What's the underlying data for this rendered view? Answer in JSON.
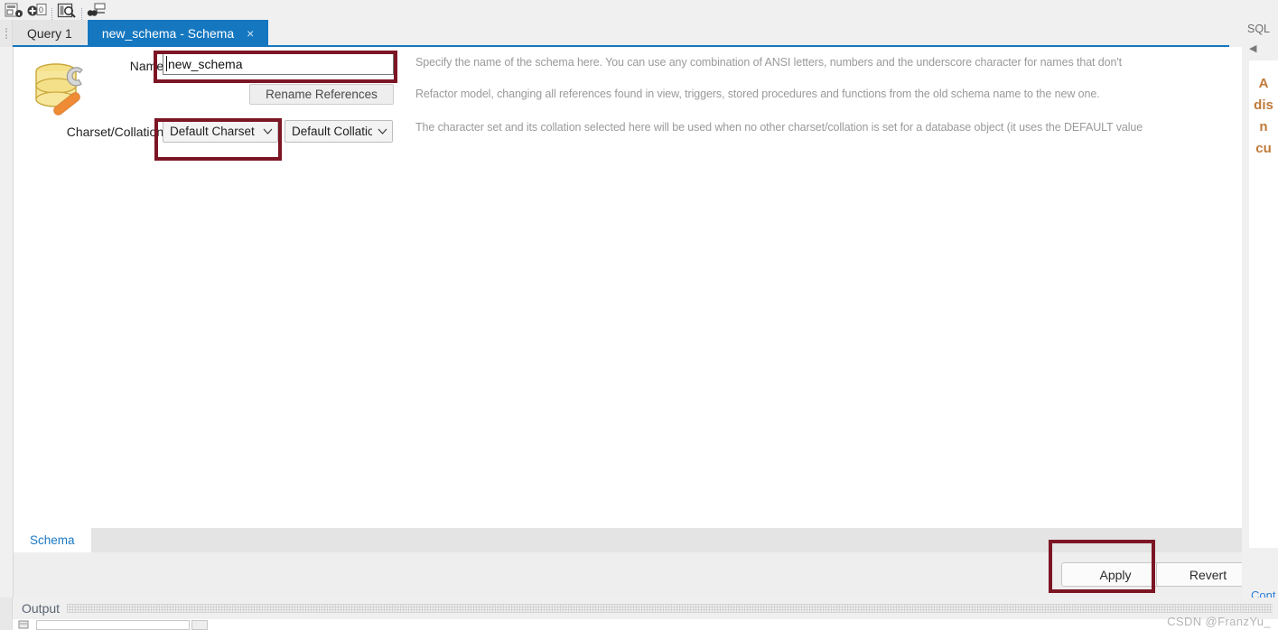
{
  "toolbar": {
    "icons": [
      {
        "name": "new-schema-icon",
        "glyph": "schema"
      },
      {
        "name": "add-table-icon",
        "glyph": "add"
      },
      {
        "name": "inspector-icon",
        "glyph": "inspect"
      },
      {
        "name": "reverse-engineer-icon",
        "glyph": "reverse"
      }
    ]
  },
  "tabs": [
    {
      "label": "Query 1",
      "active": false,
      "closable": false
    },
    {
      "label": "new_schema - Schema",
      "active": true,
      "closable": true,
      "close_glyph": "×"
    }
  ],
  "editor": {
    "object_icon": "database-wrench-icon",
    "name_label": "Name:",
    "name_value": "new_schema",
    "name_placeholder": "",
    "rename_button": "Rename References",
    "charset_label": "Charset/Collation:",
    "charset_value": "Default Charset",
    "collation_value": "Default Collation",
    "dropdown_arrow": "⌄",
    "help_name": "Specify the name of the schema here. You can use any combination of ANSI letters, numbers and the underscore character for names that don't",
    "help_rename": "Refactor model, changing all references found in view, triggers, stored procedures and functions from the old schema name to the new one.",
    "help_charset": "The character set and its collation selected here will be used when no other charset/collation is set for a database object (it uses the DEFAULT value"
  },
  "bottom_tabs": [
    {
      "label": "Schema",
      "active": true
    }
  ],
  "actions": {
    "apply_label": "Apply",
    "revert_label": "Revert"
  },
  "side_panel": {
    "header": "SQL",
    "collapse_glyph": "◀",
    "hint_lines": [
      "A",
      "dis",
      "n",
      "cu"
    ],
    "link": "Cont"
  },
  "output": {
    "label": "Output",
    "icon": "output-pane-icon"
  },
  "watermark": "CSDN @FranzYu_",
  "colors": {
    "accent_blue": "#1577c0",
    "highlight_red": "#7c1524",
    "link_blue": "#2b7fd4",
    "hint_orange": "#c07a3a"
  }
}
